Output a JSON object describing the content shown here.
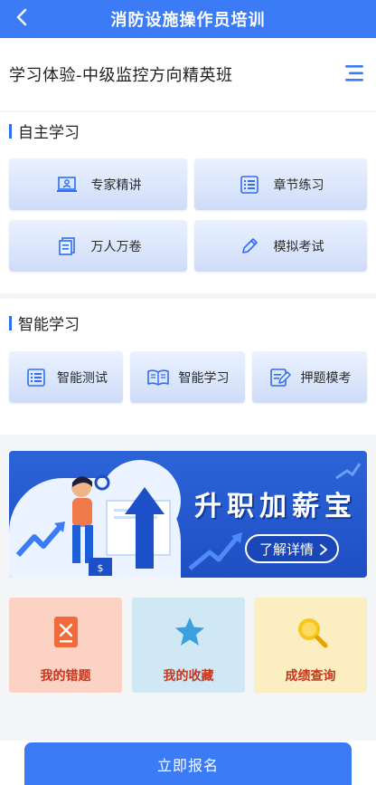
{
  "header": {
    "title": "消防设施操作员培训"
  },
  "course": {
    "title": "学习体验-中级监控方向精英班"
  },
  "self_study": {
    "title": "自主学习",
    "items": [
      {
        "label": "专家精讲",
        "icon": "expert-lecture-icon"
      },
      {
        "label": "章节练习",
        "icon": "chapter-list-icon"
      },
      {
        "label": "万人万卷",
        "icon": "papers-icon"
      },
      {
        "label": "模拟考试",
        "icon": "pen-icon"
      }
    ]
  },
  "smart_study": {
    "title": "智能学习",
    "items": [
      {
        "label": "智能测试",
        "icon": "test-list-icon"
      },
      {
        "label": "智能学习",
        "icon": "open-book-icon"
      },
      {
        "label": "押题模考",
        "icon": "edit-paper-icon"
      }
    ]
  },
  "banner": {
    "slogan": "升职加薪宝",
    "cta": "了解详情"
  },
  "cards": [
    {
      "label": "我的错题",
      "color": "#c8361d",
      "bg": "#fbd2c4"
    },
    {
      "label": "我的收藏",
      "color": "#c8361d",
      "bg": "#cfe8f4"
    },
    {
      "label": "成绩查询",
      "color": "#c8361d",
      "bg": "#fbeec1"
    }
  ],
  "bottom": {
    "signup": "立即报名"
  },
  "colors": {
    "primary": "#3b7bf6",
    "accent": "#2f6df5"
  }
}
